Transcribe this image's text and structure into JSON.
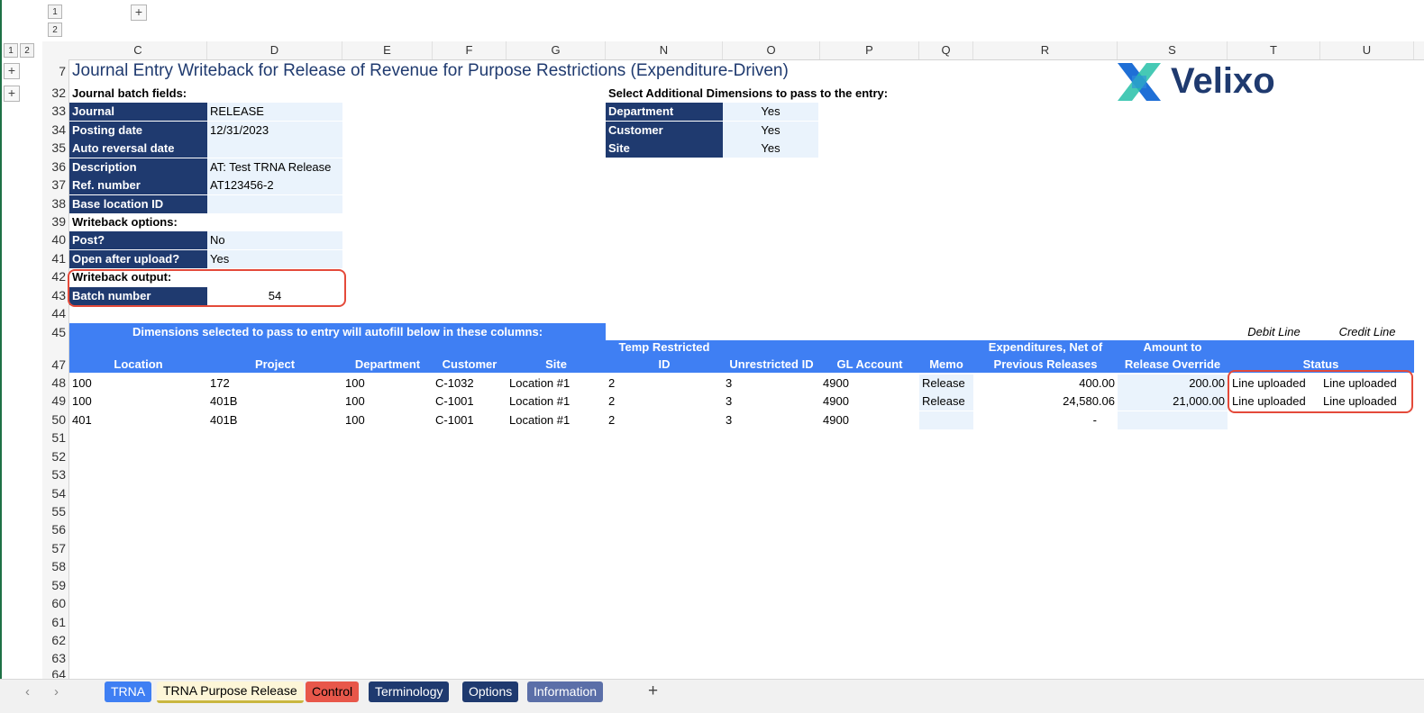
{
  "outline": {
    "top_levels": [
      "1",
      "2"
    ],
    "left_levels": [
      "1",
      "2"
    ],
    "plus": "+"
  },
  "columns": [
    "C",
    "D",
    "E",
    "F",
    "G",
    "N",
    "O",
    "P",
    "Q",
    "R",
    "S",
    "T",
    "U"
  ],
  "rows": [
    "7",
    "32",
    "33",
    "34",
    "35",
    "36",
    "37",
    "38",
    "39",
    "40",
    "41",
    "42",
    "43",
    "44",
    "45",
    "47",
    "48",
    "49",
    "50",
    "51",
    "52",
    "53",
    "54",
    "55",
    "56",
    "57",
    "58",
    "59",
    "60",
    "61",
    "62",
    "63",
    "64"
  ],
  "title": "Journal Entry Writeback for Release of Revenue for Purpose Restrictions (Expenditure-Driven)",
  "logo": {
    "text": "Velixo"
  },
  "batch": {
    "heading": "Journal batch fields:",
    "fields": [
      {
        "label": "Journal",
        "value": "RELEASE"
      },
      {
        "label": "Posting date",
        "value": "12/31/2023"
      },
      {
        "label": "Auto reversal date",
        "value": ""
      },
      {
        "label": "Description",
        "value": "AT: Test TRNA Release"
      },
      {
        "label": "Ref. number",
        "value": "AT123456-2"
      },
      {
        "label": "Base location ID",
        "value": ""
      }
    ]
  },
  "writeback_options": {
    "heading": "Writeback options:",
    "fields": [
      {
        "label": "Post?",
        "value": "No"
      },
      {
        "label": "Open after upload?",
        "value": "Yes"
      }
    ]
  },
  "writeback_output": {
    "heading": "Writeback output:",
    "label": "Batch number",
    "value": "54"
  },
  "dimensions": {
    "heading": "Select Additional Dimensions to pass to the entry:",
    "items": [
      {
        "label": "Department",
        "value": "Yes"
      },
      {
        "label": "Customer",
        "value": "Yes"
      },
      {
        "label": "Site",
        "value": "Yes"
      }
    ]
  },
  "table": {
    "banner": "Dimensions selected to pass to entry will autofill below in these columns:",
    "debit_line": "Debit Line",
    "credit_line": "Credit Line",
    "headers": {
      "location": "Location",
      "project": "Project",
      "department": "Department",
      "customer": "Customer",
      "site": "Site",
      "temp_1": "Temp Restricted",
      "temp_2": "ID",
      "unrestricted": "Unrestricted ID",
      "gl": "GL Account",
      "memo": "Memo",
      "exp_1": "Expenditures, Net of",
      "exp_2": "Previous Releases",
      "amt_1": "Amount to",
      "amt_2": "Release Override",
      "status": "Status"
    },
    "rows": [
      {
        "location": "100",
        "project": "172",
        "department": "100",
        "customer": "C-1032",
        "site": "Location #1",
        "temp": "2",
        "unrestricted": "3",
        "gl": "4900",
        "memo": "Release",
        "exp": "400.00",
        "amt": "200.00",
        "debit": "Line uploaded",
        "credit": "Line uploaded"
      },
      {
        "location": "100",
        "project": "401B",
        "department": "100",
        "customer": "C-1001",
        "site": "Location #1",
        "temp": "2",
        "unrestricted": "3",
        "gl": "4900",
        "memo": "Release",
        "exp": "24,580.06",
        "amt": "21,000.00",
        "debit": "Line uploaded",
        "credit": "Line uploaded"
      },
      {
        "location": "401",
        "project": "401B",
        "department": "100",
        "customer": "C-1001",
        "site": "Location #1",
        "temp": "2",
        "unrestricted": "3",
        "gl": "4900",
        "memo": "",
        "exp": "-",
        "amt": "",
        "debit": "",
        "credit": ""
      }
    ]
  },
  "tabs": [
    {
      "label": "TRNA",
      "color": "#3f7ff3"
    },
    {
      "label": "TRNA Purpose Release",
      "color": "#fdf6d8"
    },
    {
      "label": "Control",
      "color": "#e8574a"
    },
    {
      "label": "Terminology",
      "color": "#1f3a6f"
    },
    {
      "label": "Options",
      "color": "#1f3a6f"
    },
    {
      "label": "Information",
      "color": "#5b6fa8"
    }
  ],
  "add_sheet": "+",
  "nav": {
    "prev": "‹",
    "next": "›"
  }
}
